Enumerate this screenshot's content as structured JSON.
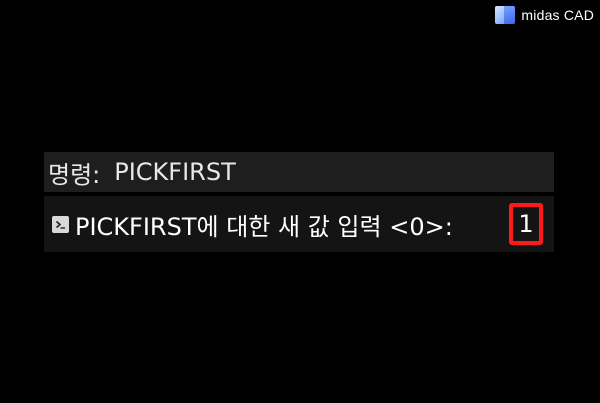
{
  "brand": {
    "name": "midas CAD"
  },
  "command_line": {
    "history_label": "명령:",
    "history_command": "PICKFIRST",
    "prompt_text": "PICKFIRST에 대한 새 값 입력 <0>:",
    "input_value": "1"
  },
  "colors": {
    "background": "#000000",
    "highlight": "#ff1a1a"
  },
  "icons": {
    "prompt": "terminal-prompt-icon",
    "logo": "midas-logo-icon"
  }
}
